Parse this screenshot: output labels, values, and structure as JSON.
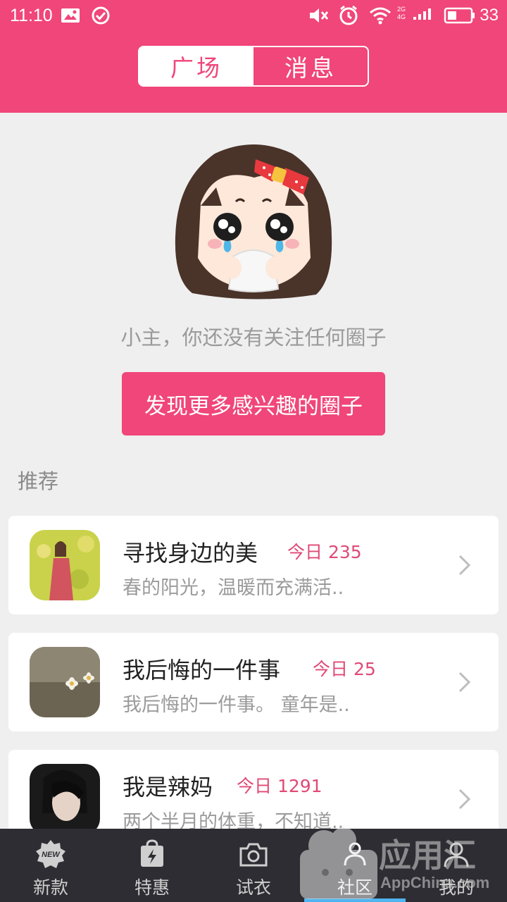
{
  "status_bar": {
    "time": "11:10",
    "battery_level": "33",
    "network_labels": [
      "2G",
      "4G"
    ]
  },
  "tabs": [
    {
      "label": "广场",
      "active": true
    },
    {
      "label": "消息",
      "active": false
    }
  ],
  "empty_state": {
    "message": "小主，你还没有关注任何圈子",
    "button_label": "发现更多感兴趣的圈子"
  },
  "section_label": "推荐",
  "circles": [
    {
      "title": "寻找身边的美",
      "today": "今日 235",
      "description": "春的阳光，温暖而充满活.."
    },
    {
      "title": "我后悔的一件事",
      "today": "今日 25",
      "description": "我后悔的一件事。 童年是.."
    },
    {
      "title": "我是辣妈",
      "today": "今日 1291",
      "description": "两个半月的体重，不知道.."
    }
  ],
  "nav": [
    {
      "label": "新款",
      "icon": "new-icon",
      "active": false
    },
    {
      "label": "特惠",
      "icon": "lightning-bag-icon",
      "active": false
    },
    {
      "label": "试衣",
      "icon": "camera-icon",
      "active": false
    },
    {
      "label": "社区",
      "icon": "community-icon",
      "active": true
    },
    {
      "label": "我的",
      "icon": "profile-icon",
      "active": false
    }
  ],
  "watermark": {
    "text_cn": "应用汇",
    "text_en": "AppChina.com"
  },
  "colors": {
    "accent": "#f0467a",
    "nav_bg": "#2d2d33",
    "nav_indicator": "#4fb5f0"
  }
}
